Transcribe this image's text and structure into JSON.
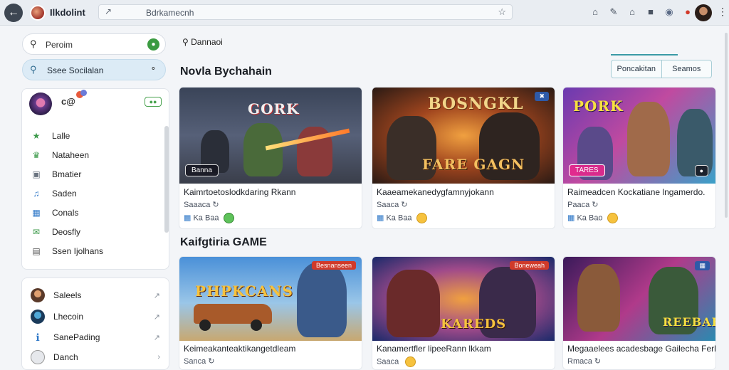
{
  "topbar": {
    "app_title": "Ilkdolint",
    "url": "Bdrkamecnh",
    "icons": [
      "home-icon",
      "edit-icon",
      "house-icon",
      "lock-icon",
      "globe-icon",
      "notification-icon"
    ]
  },
  "sidebar": {
    "search_label": "Peroim",
    "social_label": "Ssee Socilalan",
    "user_name": "c@",
    "nav": [
      {
        "label": "Lalle",
        "icon": "bug-icon",
        "color": "#3c9a4a"
      },
      {
        "label": "Nataheen",
        "icon": "people-icon",
        "color": "#3c9a4a"
      },
      {
        "label": "Bmatier",
        "icon": "monitor-icon",
        "color": "#6b7480"
      },
      {
        "label": "Saden",
        "icon": "music-icon",
        "color": "#2f78c8"
      },
      {
        "label": "Conals",
        "icon": "chart-icon",
        "color": "#2f78c8"
      },
      {
        "label": "Deosfly",
        "icon": "mail-icon",
        "color": "#3c9a4a"
      },
      {
        "label": "Ssen Ijolhans",
        "icon": "film-icon",
        "color": "#555"
      }
    ],
    "friends": [
      {
        "label": "Saleels"
      },
      {
        "label": "Lhecoin"
      },
      {
        "label": "SanePading"
      },
      {
        "label": "Danch"
      }
    ]
  },
  "main": {
    "breadcrumb": "Dannaoi",
    "section1_title": "Novla Bychahain",
    "section2_title": "Kaifgtiria GAME",
    "tabs": [
      "Poncakitan",
      "Seamos"
    ],
    "row1": [
      {
        "logo": "GORK",
        "label": "Banna",
        "title": "Kaimrtoetoslodkdaring Rkann",
        "sub": "Saaaca",
        "meta": "Ka Baa"
      },
      {
        "logo": "BOSNGKL",
        "logo2": "FARE GAGN",
        "title": "Kaaeamekanedygfamnyjokann",
        "sub": "Saaca",
        "meta": "Ka Baa"
      },
      {
        "logo": "PORK",
        "label": "TARES",
        "title": "Raimeadcen Kockatiane lngamerdo.",
        "sub": "Paaca",
        "meta": "Ka Bao"
      }
    ],
    "row2": [
      {
        "logo": "PHPKCANS",
        "tag": "Besnanseen",
        "title": "Keimeakanteaktikangetdleam",
        "sub": "Sanca"
      },
      {
        "logo": "KAREDS",
        "tag": "Boneweah",
        "title": "Kanamertfler lipeeRann lkkam",
        "sub": "Saaca"
      },
      {
        "logo": "REEBAE",
        "title": "Megaaelees acadesbage Gailecha Ferlis...",
        "sub": "Rmaca"
      }
    ]
  }
}
